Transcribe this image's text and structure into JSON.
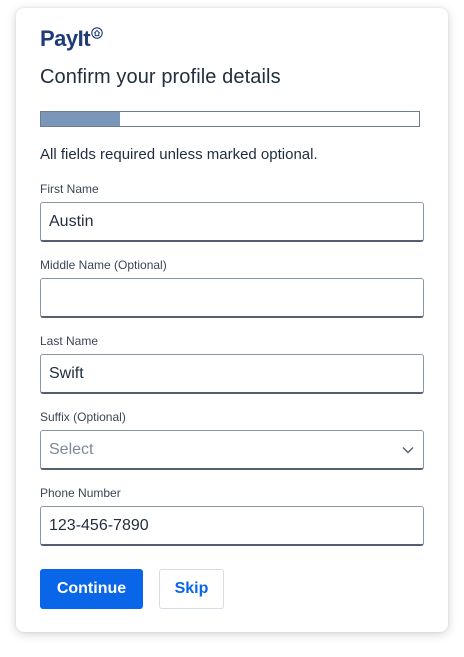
{
  "brand": {
    "name": "PayIt",
    "logo_icon": "house-badge-icon",
    "color": "#1f3b78"
  },
  "page": {
    "title": "Confirm your profile details",
    "helper_text": "All fields required unless marked optional."
  },
  "progress": {
    "fraction": 0.21,
    "fill_color": "#7a96b8"
  },
  "form": {
    "first_name": {
      "label": "First Name",
      "value": "Austin",
      "placeholder": ""
    },
    "middle_name": {
      "label": "Middle Name (Optional)",
      "value": "",
      "placeholder": ""
    },
    "last_name": {
      "label": "Last Name",
      "value": "Swift",
      "placeholder": ""
    },
    "suffix": {
      "label": "Suffix (Optional)",
      "selected": "Select",
      "icon": "chevron-down-icon"
    },
    "phone": {
      "label": "Phone Number",
      "value": "123-456-7890",
      "placeholder": ""
    }
  },
  "actions": {
    "continue_label": "Continue",
    "skip_label": "Skip",
    "accent_color": "#0a66e8"
  }
}
